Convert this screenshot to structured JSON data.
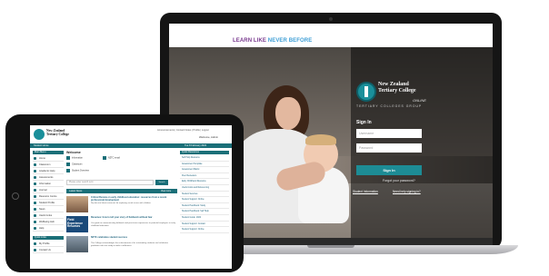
{
  "laptop": {
    "tagline_part1": "LEARN LIKE",
    "tagline_part2": "NEVER BEFORE",
    "logo": {
      "line1": "New Zealand",
      "line2": "Tertiary College",
      "online": "ONLINE",
      "group": "TERTIARY COLLEGES GROUP"
    },
    "signin": {
      "title": "Sign In",
      "username_placeholder": "Username",
      "password_placeholder": "Password",
      "button": "Sign In",
      "forgot": "Forgot your password?",
      "student_info": "Student Information",
      "need_help": "Need help signing in?"
    },
    "colors": {
      "accent_teal": "#1d8c95",
      "tagline_purple": "#7a3b8f",
      "tagline_blue": "#3f9fd6"
    }
  },
  "tablet": {
    "logo": {
      "line1": "New Zealand",
      "line2": "Tertiary College"
    },
    "top_links": "Announcements | Contact Notes | Profile | Logout",
    "welcome": "Welcome, Admin",
    "navbar_left": "Student Home",
    "navbar_right": "Tue 8 February 2022",
    "sidebar": {
      "heading": "Main Menu",
      "items": [
        "Home",
        "Classroom",
        "Academic Help",
        "Assessments",
        "Information",
        "Journal",
        "Resource Centre",
        "Student Profile",
        "News",
        "Useful Links",
        "Wellbeing Hub",
        "Help"
      ],
      "heading2": "Quick Links",
      "items2": [
        "My Profile",
        "Contact Us"
      ]
    },
    "main": {
      "title": "Welcome",
      "mini_links": [
        "Information",
        "Classroom",
        "Student Overview",
        "NZTC email"
      ],
      "search_placeholder": "Please enter search term",
      "search_button": "Search",
      "section_title": "Latest News",
      "section_more": "View more",
      "news": [
        {
          "headline": "Critical Review on early childhood education: resources from a recent professional development",
          "body": "Dip into our latest resources for exploring social issues with children."
        },
        {
          "headline": "Resumes: how to tell your story of fieldwork without fear",
          "body": "Our guide to communicating fieldwork and practicum experiences to potential employers in early childhood education.",
          "thumb_text": "Field Experience Resumes"
        },
        {
          "headline": "NZTC celebrates student success",
          "body": "The College acknowledges the achievements of its outstanding students and celebrates graduates who are ready to make a difference."
        }
      ]
    },
    "right_panel": {
      "heading": "Quick Resources",
      "items": [
        "Self Help Resource",
        "Assessment Template",
        "Assessment Matrix",
        "Peer Reviewers",
        "Early Childhood Resource",
        "Useful Links and Referencing",
        "Student Services",
        "Student Support: Online",
        "Student Handbook: Study",
        "Student Handbook: Self Help",
        "Student Guide: 2022",
        "Student Support: Contact",
        "Student Support: Online"
      ]
    },
    "colors": {
      "accent": "#1a6f78",
      "link": "#1a5f7a"
    }
  }
}
